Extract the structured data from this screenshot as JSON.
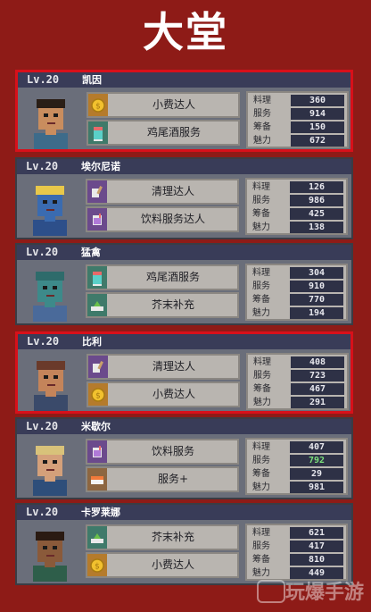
{
  "screen_title": "大堂",
  "stat_labels": [
    "料理",
    "服务",
    "筹备",
    "魅力"
  ],
  "cards": [
    {
      "level": "Lv.20",
      "name": "凯因",
      "selected": true,
      "skills": [
        {
          "label": "小费达人",
          "icon": "coin-icon"
        },
        {
          "label": "鸡尾酒服务",
          "icon": "cocktail-icon"
        }
      ],
      "stats": {
        "cooking": "360",
        "service": "914",
        "prep": "150",
        "charm": "672"
      }
    },
    {
      "level": "Lv.20",
      "name": "埃尔尼诺",
      "selected": false,
      "skills": [
        {
          "label": "清理达人",
          "icon": "cleaning-icon"
        },
        {
          "label": "饮料服务达人",
          "icon": "drink-icon"
        }
      ],
      "stats": {
        "cooking": "126",
        "service": "986",
        "prep": "425",
        "charm": "138"
      }
    },
    {
      "level": "Lv.20",
      "name": "猛禽",
      "selected": false,
      "skills": [
        {
          "label": "鸡尾酒服务",
          "icon": "cocktail-icon"
        },
        {
          "label": "芥末补充",
          "icon": "wasabi-icon"
        }
      ],
      "stats": {
        "cooking": "304",
        "service": "910",
        "prep": "770",
        "charm": "194"
      }
    },
    {
      "level": "Lv.20",
      "name": "比利",
      "selected": true,
      "skills": [
        {
          "label": "清理达人",
          "icon": "cleaning-icon"
        },
        {
          "label": "小费达人",
          "icon": "coin-icon"
        }
      ],
      "stats": {
        "cooking": "408",
        "service": "723",
        "prep": "467",
        "charm": "291"
      }
    },
    {
      "level": "Lv.20",
      "name": "米歇尔",
      "selected": false,
      "skills": [
        {
          "label": "饮料服务",
          "icon": "drink-icon"
        },
        {
          "label": "服务+",
          "icon": "sushi-icon"
        }
      ],
      "stats": {
        "cooking": "407",
        "service": "792",
        "prep": "29",
        "charm": "981"
      },
      "boosted": "service"
    },
    {
      "level": "Lv.20",
      "name": "卡罗莱娜",
      "selected": false,
      "skills": [
        {
          "label": "芥末补充",
          "icon": "wasabi-icon"
        },
        {
          "label": "小费达人",
          "icon": "coin-icon"
        }
      ],
      "stats": {
        "cooking": "621",
        "service": "417",
        "prep": "810",
        "charm": "449"
      }
    }
  ],
  "watermark": "玩爆手游",
  "colors": {
    "background": "#8e1b17",
    "card_header": "#393c58",
    "selected_border": "#d8101a",
    "stat_value_bg": "#2e3146",
    "boost_value": "#7be07b"
  }
}
